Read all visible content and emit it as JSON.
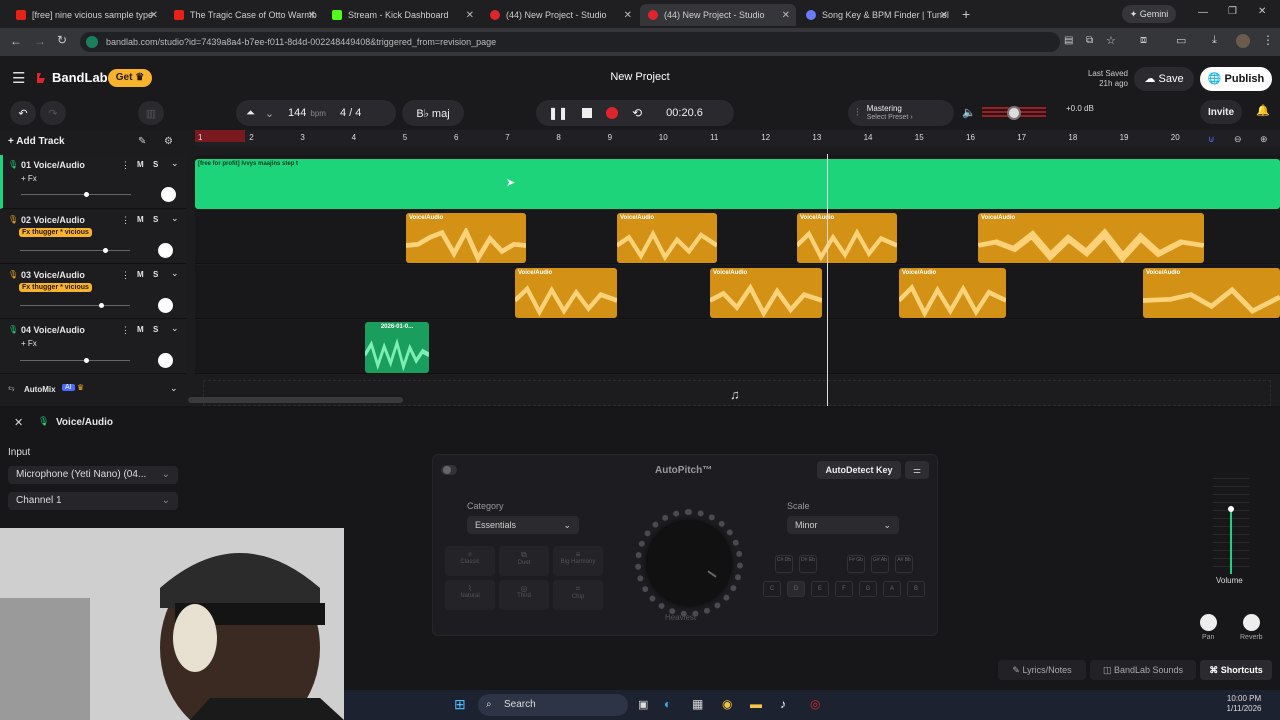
{
  "browser": {
    "tabs": [
      {
        "label": "[free] nine vicious sample type",
        "active": false
      },
      {
        "label": "The Tragic Case of Otto Warmb",
        "active": false
      },
      {
        "label": "Stream - Kick Dashboard",
        "active": false
      },
      {
        "label": "(44) New Project - Studio",
        "active": false
      },
      {
        "label": "(44) New Project - Studio",
        "active": true
      },
      {
        "label": "Song Key & BPM Finder | Tunel",
        "active": false
      }
    ],
    "profile": "Gemini",
    "url": "bandlab.com/studio?id=7439a8a4-b7ee-f011-8d4d-002248449408&triggered_from=revision_page"
  },
  "app": {
    "brand": "BandLab",
    "get_label": "Get",
    "project_title": "New Project",
    "last_saved_label": "Last Saved",
    "last_saved_time": "21h ago",
    "save_label": "Save",
    "publish_label": "Publish"
  },
  "toolbar": {
    "bpm": "144",
    "bpm_unit": "bpm",
    "time_sig": "4 / 4",
    "key": "B♭ maj",
    "time": "00:20.6",
    "mastering_title": "Mastering",
    "mastering_sub": "Select Preset",
    "volume_db": "+0.0 dB",
    "volume_level": 0.5,
    "invite_label": "Invite"
  },
  "tracks_header": {
    "add_track_label": "Add Track",
    "automix_label": "AutoMix",
    "ai_badge": "AI"
  },
  "ruler": [
    "1",
    "2",
    "3",
    "4",
    "5",
    "6",
    "7",
    "8",
    "9",
    "10",
    "11",
    "12",
    "13",
    "14",
    "15",
    "16",
    "17",
    "18",
    "19",
    "20"
  ],
  "tracks": [
    {
      "name": "01  Voice/Audio",
      "fx": "+ Fx",
      "mute": "M",
      "solo": "S",
      "volume": 0.59
    },
    {
      "name": "02  Voice/Audio",
      "fx": "Fx thugger * vicious",
      "mute": "M",
      "solo": "S",
      "volume": 0.77
    },
    {
      "name": "03  Voice/Audio",
      "fx": "Fx thugger * vicious",
      "mute": "M",
      "solo": "S",
      "volume": 0.74
    },
    {
      "name": "04  Voice/Audio",
      "fx": "+ Fx",
      "mute": "M",
      "solo": "S",
      "volume": 0.6
    }
  ],
  "clips": {
    "track1_label": "[free for profit] lvvys maajins step t",
    "voice_label": "Voice/Audio",
    "track4_label": "2026-01-0..."
  },
  "panel": {
    "title": "Voice/Audio",
    "input_label": "Input",
    "input_device": "Microphone (Yeti Nano) (04...",
    "channel": "Channel 1",
    "autopitch_title": "AutoPitch™",
    "autodetect_label": "AutoDetect Key",
    "category_label": "Category",
    "category_value": "Essentials",
    "effects": [
      "Classic",
      "Duet",
      "Big Harmony",
      "Natural",
      "Third",
      "Chip"
    ],
    "knob_label": "Heaviest",
    "scale_label": "Scale",
    "scale_value": "Minor",
    "sharp_keys": [
      "C#\nDb",
      "D#\nEb",
      "F#\nGb",
      "G#\nAb",
      "A#\nBb"
    ],
    "keys": [
      "C",
      "D",
      "E",
      "F",
      "G",
      "A",
      "B"
    ],
    "volume_label": "Volume",
    "pan_label": "Pan",
    "reverb_label": "Reverb",
    "lyrics_label": "Lyrics/Notes",
    "sounds_label": "BandLab Sounds",
    "shortcuts_label": "Shortcuts"
  },
  "taskbar": {
    "search": "Search",
    "time": "10:00 PM",
    "date": "1/11/2026"
  },
  "colors": {
    "green": "#1ed47a",
    "orange": "#f5a623",
    "red": "#e0242b",
    "accent_yellow": "#f7b32b"
  }
}
